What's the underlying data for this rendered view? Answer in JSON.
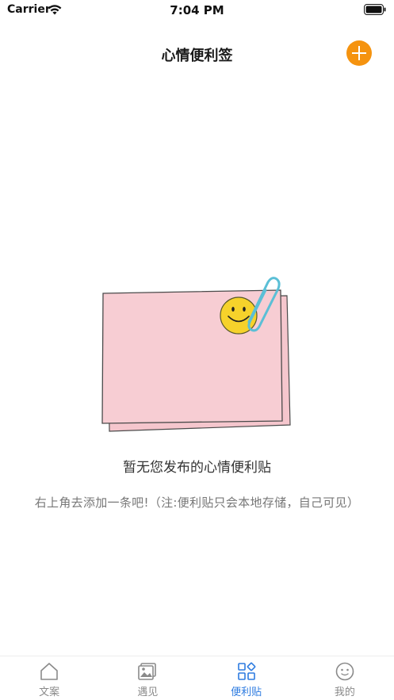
{
  "status_bar": {
    "carrier": "Carrier",
    "time": "7:04 PM",
    "wifi_icon": "wifi-icon",
    "battery_icon": "battery-icon"
  },
  "nav": {
    "title": "心情便利签",
    "add_icon": "plus-circle-icon",
    "accent_color": "#f5930f"
  },
  "empty_state": {
    "illustration": "sticky-note-smiley-paperclip",
    "title": "暂无您发布的心情便利贴",
    "hint": "右上角去添加一条吧!（注:便利贴只会本地存储，自己可见）"
  },
  "tabs": [
    {
      "label": "文案",
      "icon": "home-icon",
      "active": false
    },
    {
      "label": "遇见",
      "icon": "photo-icon",
      "active": false
    },
    {
      "label": "便利贴",
      "icon": "grid-icon",
      "active": true
    },
    {
      "label": "我的",
      "icon": "face-icon",
      "active": false
    }
  ],
  "colors": {
    "active_tab": "#2d7be0",
    "inactive_tab": "#8a8a8a",
    "note_pink": "#f7cdd3",
    "smiley_yellow": "#f6d22b",
    "clip_blue": "#5bbfd6"
  }
}
